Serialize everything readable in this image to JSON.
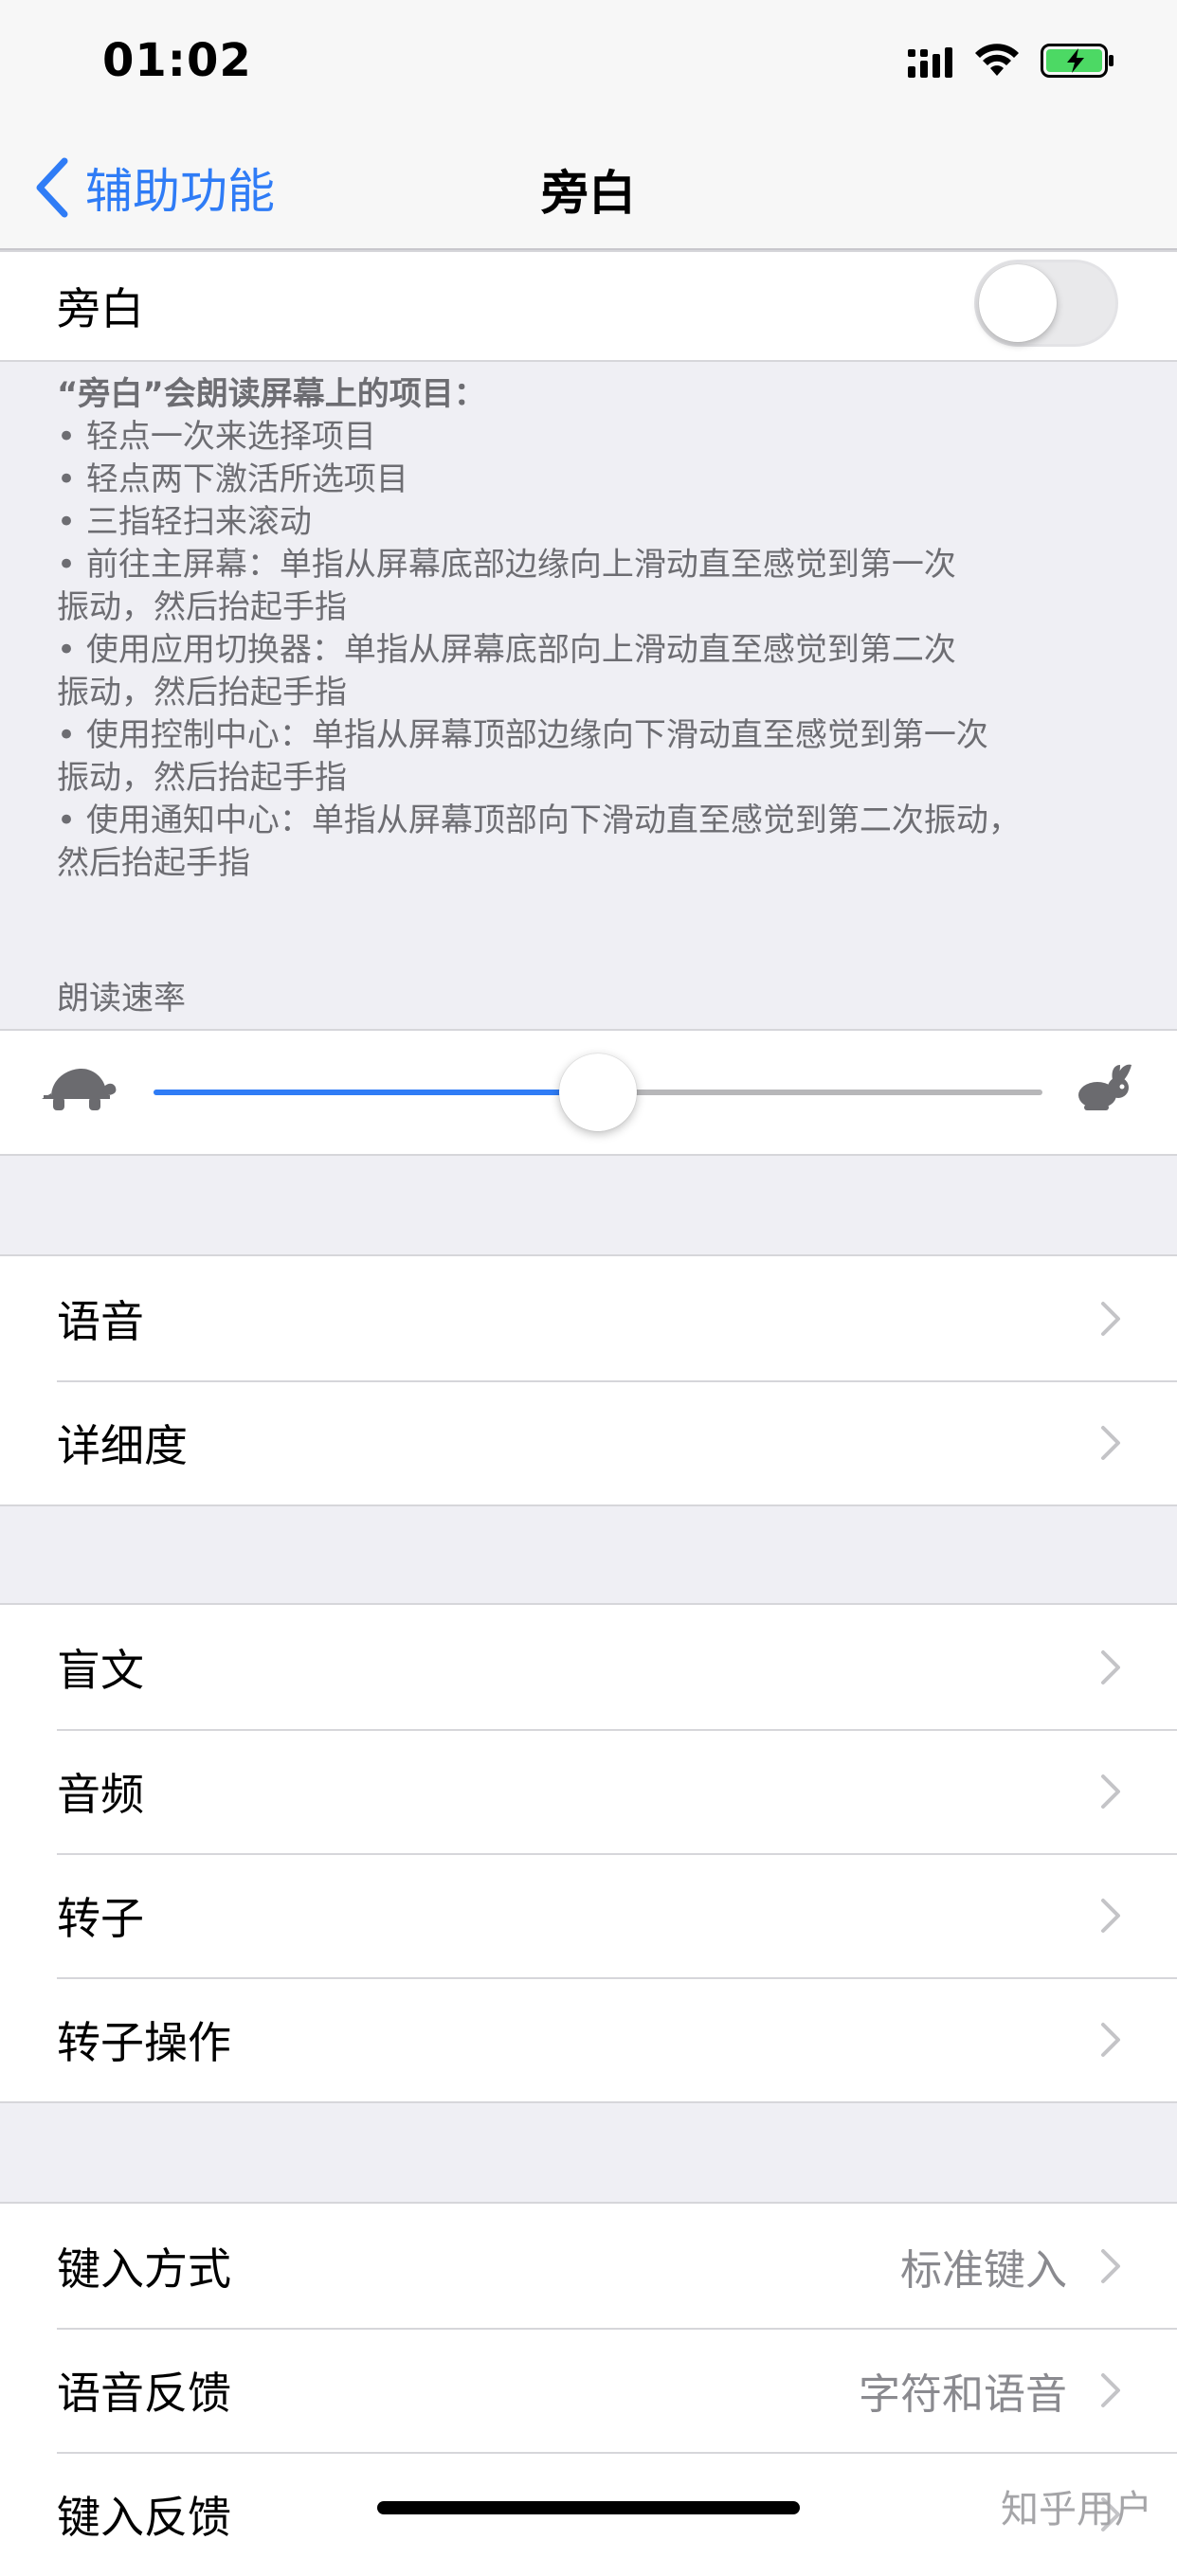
{
  "status_bar": {
    "time": "01:02"
  },
  "nav": {
    "back_label": "辅助功能",
    "title": "旁白"
  },
  "voiceover_toggle": {
    "label": "旁白",
    "enabled": false
  },
  "description": {
    "intro": "“旁白”会朗读屏幕上的项目：",
    "items": [
      "• 轻点一次来选择项目",
      "• 轻点两下激活所选项目",
      "• 三指轻扫来滚动",
      "• 前往主屏幕：单指从屏幕底部边缘向上滑动直至感觉到第一次\n振动，然后抬起手指",
      "• 使用应用切换器：单指从屏幕底部向上滑动直至感觉到第二次\n振动，然后抬起手指",
      "• 使用控制中心：单指从屏幕顶部边缘向下滑动直至感觉到第一次\n振动，然后抬起手指",
      "• 使用通知中心：单指从屏幕顶部向下滑动直至感觉到第二次振动，\n然后抬起手指"
    ]
  },
  "speaking_rate": {
    "header": "朗读速率",
    "value_percent": 50
  },
  "group1": [
    {
      "label": "语音"
    },
    {
      "label": "详细度"
    }
  ],
  "group2": [
    {
      "label": "盲文"
    },
    {
      "label": "音频"
    },
    {
      "label": "转子"
    },
    {
      "label": "转子操作"
    }
  ],
  "group3": [
    {
      "label": "键入方式",
      "value": "标准键入"
    },
    {
      "label": "语音反馈",
      "value": "字符和语音"
    },
    {
      "label": "键入反馈",
      "value": ""
    }
  ],
  "watermark": "知乎用户",
  "colors": {
    "accent": "#2f7cf6",
    "background": "#efeff4",
    "secondary_text": "#6d6d72"
  },
  "icons": [
    "signal-icon",
    "wifi-icon",
    "battery-charging-icon",
    "back-chevron-icon",
    "turtle-icon",
    "rabbit-icon",
    "chevron-right-icon"
  ]
}
